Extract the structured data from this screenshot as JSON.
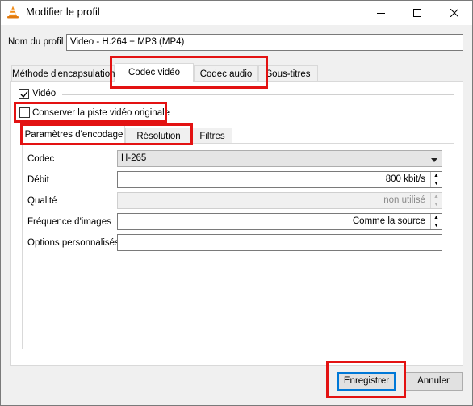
{
  "window": {
    "title": "Modifier le profil",
    "icon": "vlc-cone-icon"
  },
  "profile_name": {
    "label": "Nom du profil",
    "value": "Video - H.264 + MP3 (MP4)"
  },
  "main_tabs": [
    {
      "label": "Méthode d'encapsulation",
      "active": false
    },
    {
      "label": "Codec vidéo",
      "active": true
    },
    {
      "label": "Codec audio",
      "active": false
    },
    {
      "label": "Sous-titres",
      "active": false
    }
  ],
  "video_section": {
    "label": "Vidéo",
    "checked": true
  },
  "keep_original": {
    "label": "Conserver la piste vidéo originale",
    "checked": false
  },
  "sub_tabs": [
    {
      "label": "Paramètres d'encodage",
      "active": true
    },
    {
      "label": "Résolution",
      "active": false
    },
    {
      "label": "Filtres",
      "active": false
    }
  ],
  "form": {
    "codec": {
      "label": "Codec",
      "value": "H-265"
    },
    "bitrate": {
      "label": "Débit",
      "value": "800 kbit/s"
    },
    "quality": {
      "label": "Qualité",
      "value": "non utilisé"
    },
    "framerate": {
      "label": "Fréquence d'images",
      "value": "Comme la source"
    },
    "custom_options": {
      "label": "Options personnalisés",
      "value": ""
    }
  },
  "buttons": {
    "save": "Enregistrer",
    "cancel": "Annuler"
  },
  "colors": {
    "highlight": "#e31212",
    "focus": "#0078d7"
  }
}
